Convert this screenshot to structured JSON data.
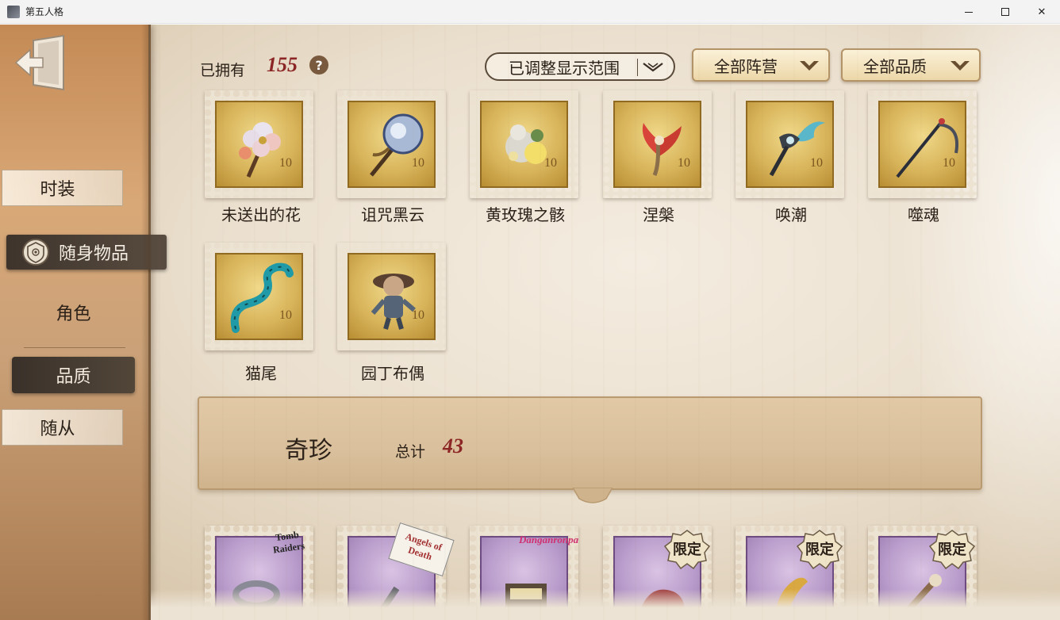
{
  "window": {
    "title": "第五人格",
    "controls": {
      "minimize": "minimize",
      "maximize": "maximize",
      "close": "✕"
    }
  },
  "sidebar": {
    "tabs": {
      "skin": "时装",
      "items": "随身物品",
      "role": "角色",
      "quality": "品质",
      "follower": "随从"
    }
  },
  "header": {
    "owned_label": "已拥有",
    "owned_count": "155",
    "help": "?",
    "filters": {
      "range": "已调整显示范围",
      "camp": "全部阵营",
      "quality": "全部品质"
    }
  },
  "items": [
    {
      "name": "未送出的花",
      "value": "10",
      "icon": "flower-icon"
    },
    {
      "name": "诅咒黑云",
      "value": "10",
      "icon": "dark-orb-icon"
    },
    {
      "name": "黄玫瑰之骸",
      "value": "10",
      "icon": "yellow-rose-icon"
    },
    {
      "name": "涅槃",
      "value": "10",
      "icon": "phoenix-icon"
    },
    {
      "name": "唤潮",
      "value": "10",
      "icon": "tide-icon"
    },
    {
      "name": "噬魂",
      "value": "10",
      "icon": "scythe-icon"
    },
    {
      "name": "猫尾",
      "value": "10",
      "icon": "cat-tail-icon"
    },
    {
      "name": "园丁布偶",
      "value": "10",
      "icon": "doll-icon"
    }
  ],
  "category": {
    "title": "奇珍",
    "total_label": "总计",
    "total": "43"
  },
  "rare_items": [
    {
      "tag": "Tomb Raiders",
      "limited": ""
    },
    {
      "tag": "Angels of Death",
      "limited": ""
    },
    {
      "tag": "Danganronpa",
      "limited": ""
    },
    {
      "tag": "",
      "limited": "限定"
    },
    {
      "tag": "",
      "limited": "限定"
    },
    {
      "tag": "",
      "limited": "限定"
    }
  ],
  "colors": {
    "accent_red": "#8c2626",
    "gold_stamp": "#d8b45a",
    "purple_stamp": "#b99ccb",
    "sidebar_dark": "#3e342c"
  }
}
